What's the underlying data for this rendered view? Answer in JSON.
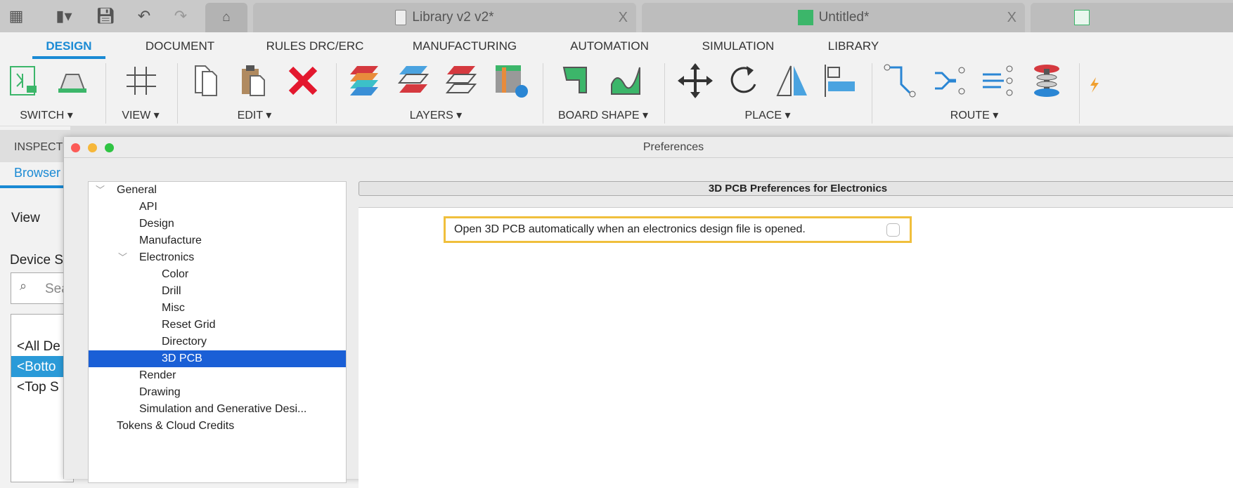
{
  "topbar": {
    "tabs": [
      {
        "label": "Library v2 v2*",
        "close": "X"
      },
      {
        "label": "Untitled*",
        "close": "X"
      }
    ]
  },
  "ribbon": {
    "tabs": [
      "DESIGN",
      "DOCUMENT",
      "RULES DRC/ERC",
      "MANUFACTURING",
      "AUTOMATION",
      "SIMULATION",
      "LIBRARY"
    ],
    "groups": [
      "SWITCH ▾",
      "VIEW ▾",
      "EDIT ▾",
      "LAYERS ▾",
      "BOARD SHAPE ▾",
      "PLACE ▾",
      "ROUTE ▾"
    ]
  },
  "left": {
    "inspector": "INSPECT",
    "browser": "Browser",
    "view": "View",
    "device": "Device S",
    "search_placeholder": "Sea",
    "items": [
      "<All De",
      "<Botto",
      "<Top S"
    ]
  },
  "dialog": {
    "title": "Preferences",
    "tree": [
      {
        "label": "General",
        "level": 0,
        "expanded": true
      },
      {
        "label": "API",
        "level": 1
      },
      {
        "label": "Design",
        "level": 1
      },
      {
        "label": "Manufacture",
        "level": 1
      },
      {
        "label": "Electronics",
        "level": 1,
        "expanded": true
      },
      {
        "label": "Color",
        "level": 2
      },
      {
        "label": "Drill",
        "level": 2
      },
      {
        "label": "Misc",
        "level": 2
      },
      {
        "label": "Reset Grid",
        "level": 2
      },
      {
        "label": "Directory",
        "level": 2
      },
      {
        "label": "3D PCB",
        "level": 2,
        "selected": true
      },
      {
        "label": "Render",
        "level": 1
      },
      {
        "label": "Drawing",
        "level": 1
      },
      {
        "label": "Simulation and Generative Desi...",
        "level": 1
      },
      {
        "label": "Tokens & Cloud Credits",
        "level": 0
      }
    ],
    "header": "3D PCB Preferences for Electronics",
    "option_label": "Open 3D PCB automatically when an electronics design file is opened.",
    "option_checked": false
  },
  "colors": {
    "accent": "#1a8ad4",
    "selection": "#1a5fd6",
    "highlight": "#f0bf3c"
  }
}
